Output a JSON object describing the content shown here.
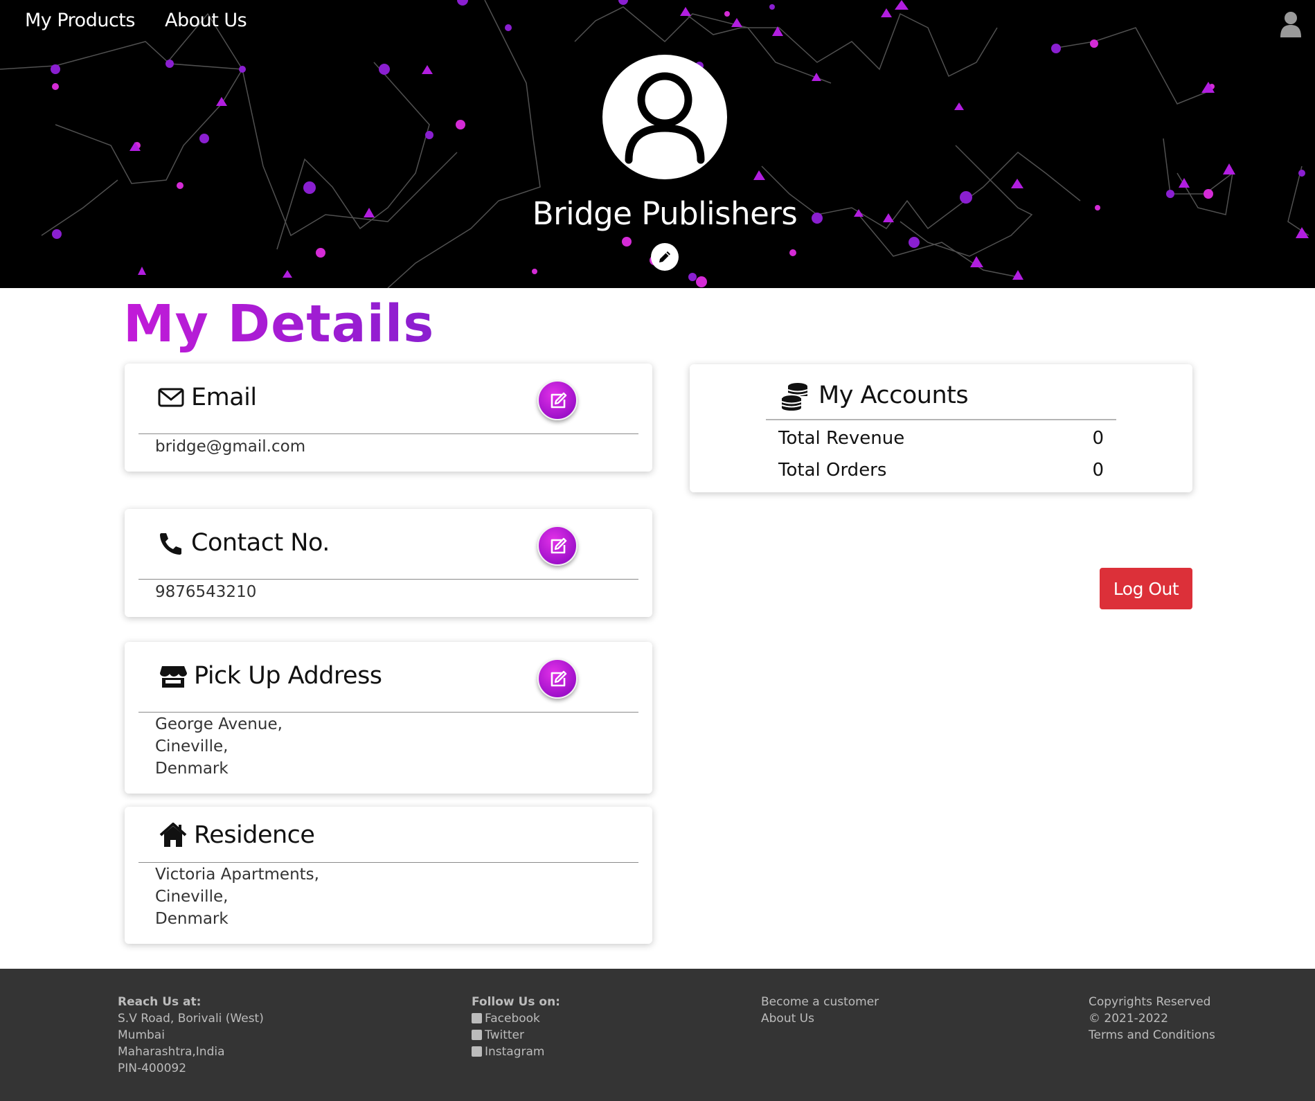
{
  "nav": {
    "products": "My Products",
    "about": "About Us"
  },
  "header": {
    "company_name": "Bridge Publishers"
  },
  "title": "My Details",
  "email": {
    "heading": "Email",
    "value": "bridge@gmail.com"
  },
  "contact": {
    "heading": "Contact No.",
    "value": "9876543210"
  },
  "pickup": {
    "heading": "Pick Up Address",
    "lines": [
      "George Avenue,",
      "Cineville,",
      "Denmark"
    ]
  },
  "residence": {
    "heading": "Residence",
    "lines": [
      "Victoria Apartments,",
      "Cineville,",
      "Denmark"
    ]
  },
  "accounts": {
    "heading": "My Accounts",
    "rows": [
      {
        "label": "Total Revenue",
        "value": "0"
      },
      {
        "label": "Total Orders",
        "value": "0"
      }
    ]
  },
  "logout_label": "Log Out",
  "footer": {
    "reach": {
      "heading": "Reach Us at:",
      "lines": [
        "S.V Road, Borivali (West)",
        "Mumbai",
        "Maharashtra,India",
        "PIN-400092"
      ]
    },
    "follow": {
      "heading": "Follow Us on:",
      "links": [
        "Facebook",
        "Twitter",
        "Instagram"
      ]
    },
    "links": [
      "Become a customer",
      "About Us"
    ],
    "legal": [
      "Copyrights Reserved",
      "© 2021-2022",
      "Terms and Conditions"
    ]
  },
  "colors": {
    "accent_purple": "#b01ad6",
    "logout_red": "#dc3039",
    "footer_bg": "#343434",
    "hero_bg": "#000000"
  }
}
